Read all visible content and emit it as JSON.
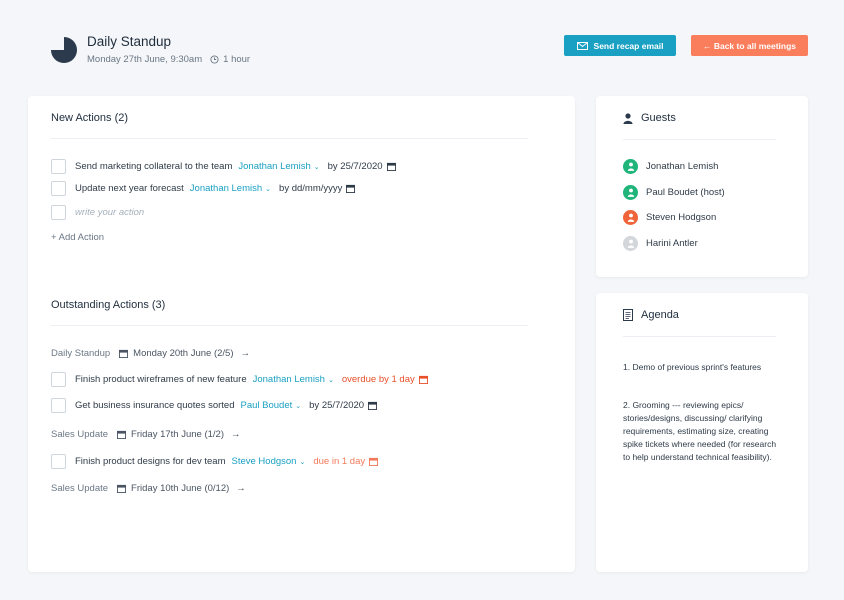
{
  "meeting": {
    "title": "Daily Standup",
    "date": "Monday 27th June, 9:30am",
    "duration": "1 hour",
    "icon": "pie-chart-logo-icon"
  },
  "actions": {
    "recap_label": "Send recap email",
    "back_label": "← Back to all meetings"
  },
  "colors": {
    "accent": "#1aa0c2",
    "back": "#fa7d5c",
    "overdue": "#e8502a",
    "due_soon": "#f27a5a"
  },
  "new_actions": {
    "heading": "New Actions (2)",
    "items": [
      {
        "text": "Send marketing collateral to the team",
        "assignee": "Jonathan Lemish",
        "due_prefix": "by",
        "due": "25/7/2020"
      },
      {
        "text": "Update next year forecast",
        "assignee": "Jonathan Lemish",
        "due_prefix": "by",
        "due": "dd/mm/yyyy"
      }
    ],
    "input_placeholder": "write your action",
    "add_label": "+ Add Action"
  },
  "outstanding": {
    "heading": "Outstanding Actions (3)",
    "groups": [
      {
        "meeting": "Daily Standup",
        "date": "Monday 20th June (2/5)",
        "items": [
          {
            "text": "Finish product wireframes of new feature",
            "assignee": "Jonathan Lemish",
            "due": "overdue by 1 day"
          },
          {
            "text": "Get business insurance quotes sorted",
            "assignee": "Paul Boudet",
            "due_prefix": "by",
            "due": "25/7/2020"
          }
        ]
      },
      {
        "meeting": "Sales Update",
        "date": "Friday 17th June (1/2)",
        "items": [
          {
            "text": "Finish product designs for dev team",
            "assignee": "Steve Hodgson",
            "due": "due in 1 day"
          }
        ]
      },
      {
        "meeting": "Sales Update",
        "date": "Friday 10th June (0/12)",
        "items": []
      }
    ]
  },
  "guests": {
    "heading": "Guests",
    "list": [
      {
        "name": "Jonathan Lemish",
        "color": "#1fb57a"
      },
      {
        "name": "Paul Boudet (host)",
        "color": "#1fb57a"
      },
      {
        "name": "Steven Hodgson",
        "color": "#f0643a"
      },
      {
        "name": "Harini Antler",
        "color": "#d3d6da"
      }
    ]
  },
  "agenda": {
    "heading": "Agenda",
    "items": [
      "1.  Demo of previous sprint's features",
      "2.  Grooming --- reviewing epics/ stories/designs, discussing/ clarifying requirements, estimating size, creating spike tickets where needed (for research to help understand technical feasibility)."
    ]
  }
}
